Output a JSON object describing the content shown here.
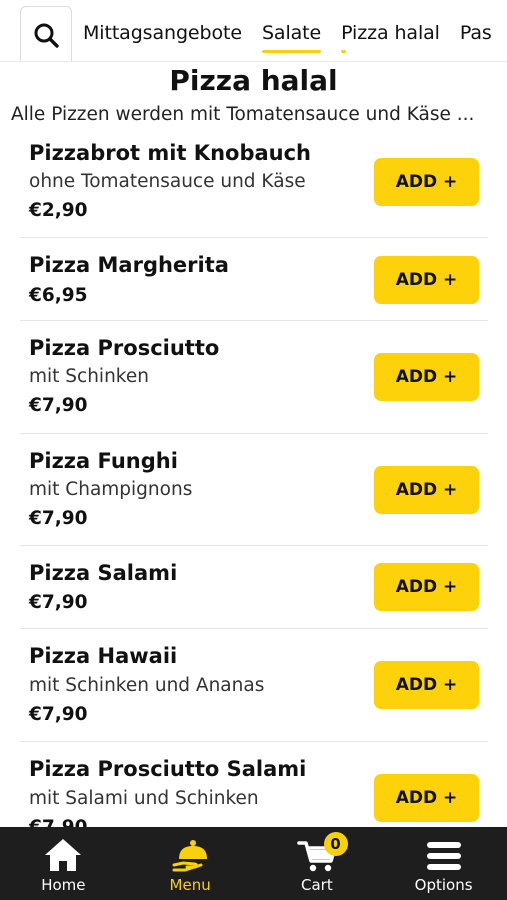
{
  "categories": {
    "search_icon": "search-icon",
    "tabs": [
      {
        "label": "Mittagsangebote"
      },
      {
        "label": "Salate"
      },
      {
        "label": "Pizza halal"
      },
      {
        "label": "Pas"
      }
    ]
  },
  "section": {
    "title": "Pizza halal",
    "description": "Alle Pizzen werden mit Tomatensauce und Käse ..."
  },
  "items": [
    {
      "name": "Pizzabrot mit Knobauch",
      "description": "ohne Tomatensauce und Käse",
      "price": "€2,90",
      "button": "ADD +"
    },
    {
      "name": "Pizza Margherita",
      "description": "",
      "price": "€6,95",
      "button": "ADD +"
    },
    {
      "name": "Pizza Prosciutto",
      "description": "mit Schinken",
      "price": "€7,90",
      "button": "ADD +"
    },
    {
      "name": "Pizza Funghi",
      "description": "mit Champignons",
      "price": "€7,90",
      "button": "ADD +"
    },
    {
      "name": "Pizza Salami",
      "description": "",
      "price": "€7,90",
      "button": "ADD +"
    },
    {
      "name": "Pizza Hawaii",
      "description": "mit Schinken und Ananas",
      "price": "€7,90",
      "button": "ADD +"
    },
    {
      "name": "Pizza Prosciutto Salami",
      "description": "mit Salami und Schinken",
      "price": "€7,90",
      "button": "ADD +"
    }
  ],
  "nav": {
    "items": [
      {
        "label": "Home",
        "icon": "home-icon"
      },
      {
        "label": "Menu",
        "icon": "cloche-icon"
      },
      {
        "label": "Cart",
        "icon": "cart-icon"
      },
      {
        "label": "Options",
        "icon": "menu-icon"
      }
    ],
    "cart_count": "0"
  },
  "colors": {
    "accent": "#fdd20a",
    "nav_background": "#1e1e1e",
    "active_nav_label": "#f6d10c"
  }
}
